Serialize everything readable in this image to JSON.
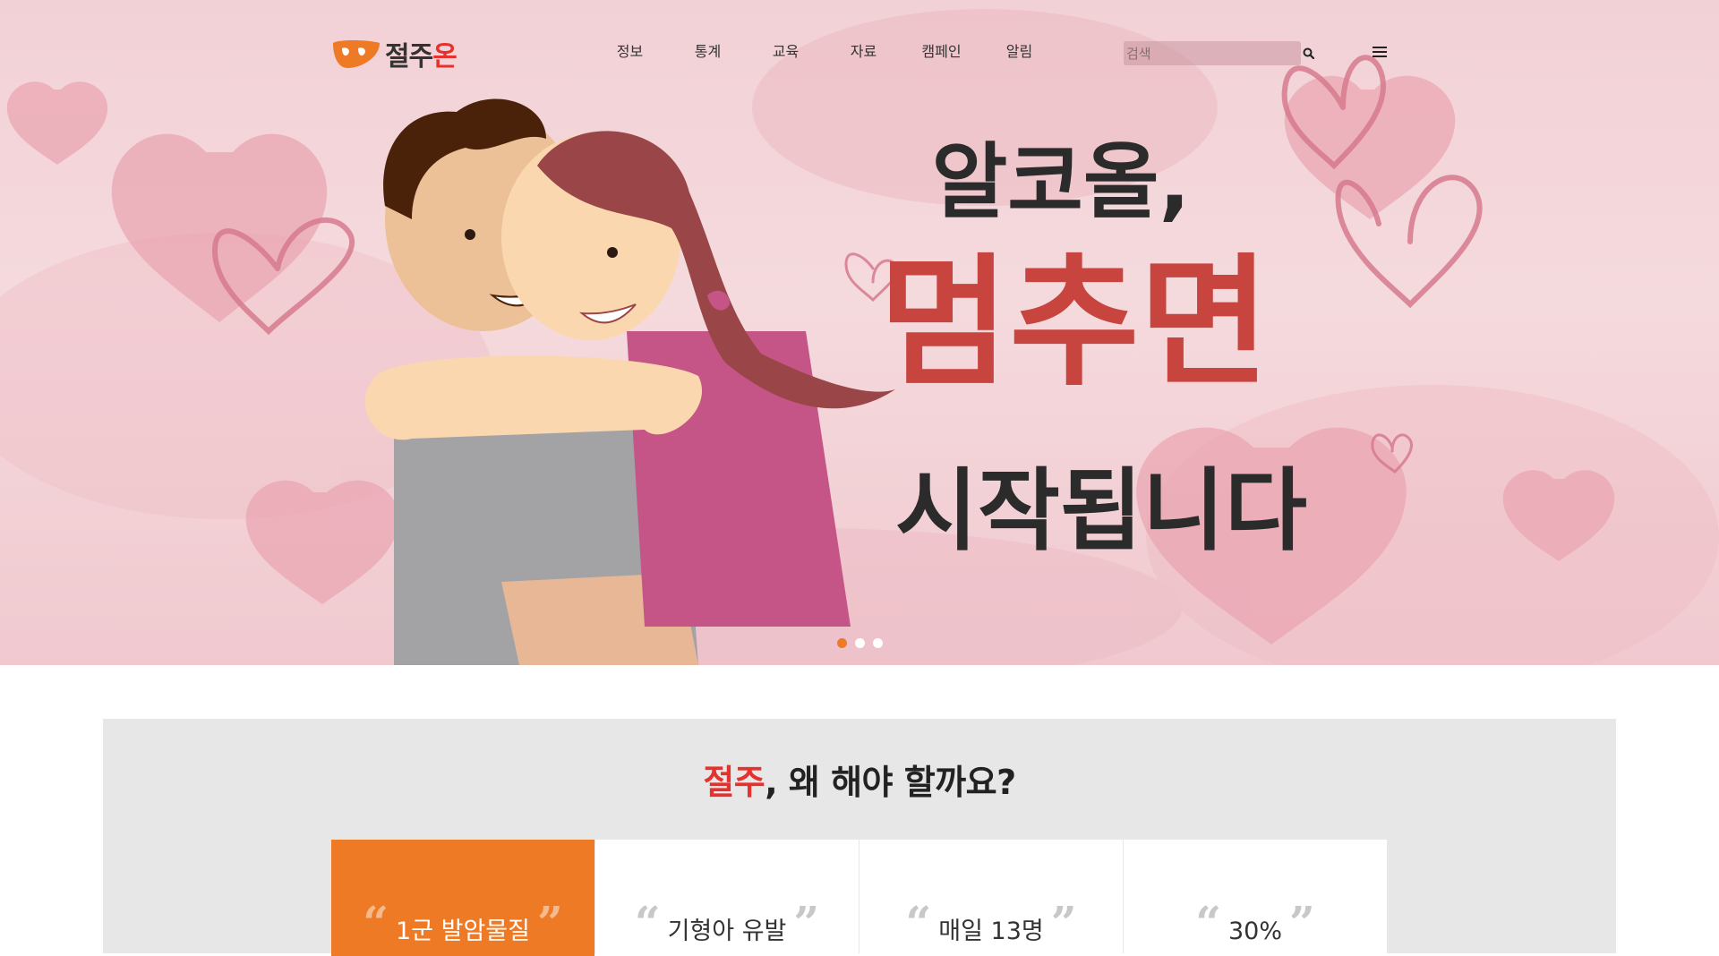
{
  "header": {
    "logo_text_dark": "절주",
    "logo_text_accent": "온",
    "nav": [
      "정보",
      "통계",
      "교육",
      "자료",
      "캠페인",
      "알림"
    ],
    "search_placeholder": "검색",
    "icons": {
      "search": "search-icon",
      "menu": "hamburger-menu-icon"
    }
  },
  "hero": {
    "line1": "알코올,",
    "line2": "멈추면",
    "line3": "시작됩니다",
    "slides": 3,
    "active_slide": 1
  },
  "why": {
    "title_accent": "절주",
    "title_rest": ", 왜 해야 할까요?",
    "cards": [
      {
        "label": "1군 발암물질",
        "active": true
      },
      {
        "label": "기형아 유발",
        "active": false
      },
      {
        "label": "매일 13명",
        "active": false
      },
      {
        "label": "30%",
        "active": false
      }
    ]
  },
  "colors": {
    "accent_orange": "#ee7a26",
    "accent_red": "#e5322c",
    "hero_pink": "#f2d1d6",
    "section_gray": "#e7e7e8"
  }
}
